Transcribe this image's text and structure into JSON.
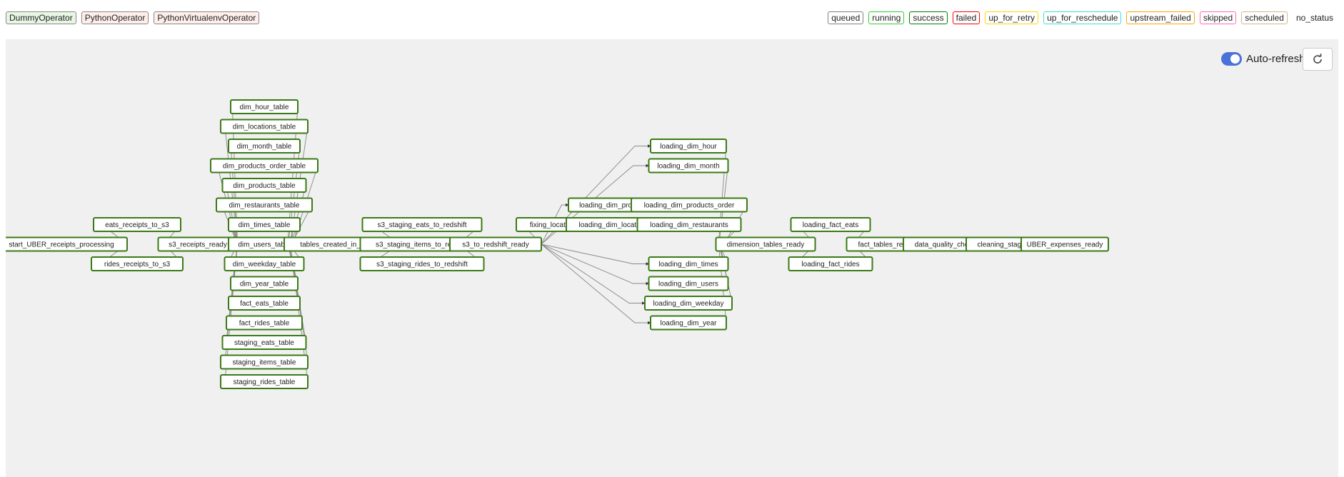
{
  "operators": [
    {
      "label": "DummyOperator",
      "color": "#e8f7e4",
      "border": "#888"
    },
    {
      "label": "PythonOperator",
      "color": "#ffefeb",
      "border": "#888"
    },
    {
      "label": "PythonVirtualenvOperator",
      "color": "#ffefeb",
      "border": "#888"
    }
  ],
  "statuses": [
    {
      "label": "queued",
      "color": "#808080"
    },
    {
      "label": "running",
      "color": "#32cd32"
    },
    {
      "label": "success",
      "color": "#008000"
    },
    {
      "label": "failed",
      "color": "#ff0000"
    },
    {
      "label": "up_for_retry",
      "color": "#ffd700"
    },
    {
      "label": "up_for_reschedule",
      "color": "#40e0d0"
    },
    {
      "label": "upstream_failed",
      "color": "#ffa500"
    },
    {
      "label": "skipped",
      "color": "#ff69b4"
    },
    {
      "label": "scheduled",
      "color": "#d2b48c"
    },
    {
      "label": "no_status",
      "color": ""
    }
  ],
  "controls": {
    "auto_refresh_label": "Auto-refresh",
    "auto_refresh_on": true,
    "refresh_icon": "refresh-icon"
  },
  "graph": {
    "node_stroke": "#3a7a15",
    "nodes": [
      {
        "id": "start_UBER_receipts_processing"
      },
      {
        "id": "eats_receipts_to_s3"
      },
      {
        "id": "rides_receipts_to_s3"
      },
      {
        "id": "s3_receipts_ready"
      },
      {
        "id": "dim_hour_table"
      },
      {
        "id": "dim_locations_table"
      },
      {
        "id": "dim_month_table"
      },
      {
        "id": "dim_products_order_table"
      },
      {
        "id": "dim_products_table"
      },
      {
        "id": "dim_restaurants_table"
      },
      {
        "id": "dim_times_table"
      },
      {
        "id": "dim_users_table"
      },
      {
        "id": "dim_weekday_table"
      },
      {
        "id": "dim_year_table"
      },
      {
        "id": "fact_eats_table"
      },
      {
        "id": "fact_rides_table"
      },
      {
        "id": "staging_eats_table"
      },
      {
        "id": "staging_items_table"
      },
      {
        "id": "staging_rides_table"
      },
      {
        "id": "tables_created_in_redshift"
      },
      {
        "id": "s3_staging_eats_to_redshift"
      },
      {
        "id": "s3_staging_items_to_redshift"
      },
      {
        "id": "s3_staging_rides_to_redshift"
      },
      {
        "id": "s3_to_redshift_ready"
      },
      {
        "id": "fixing_locations"
      },
      {
        "id": "loading_dim_products"
      },
      {
        "id": "loading_dim_locations"
      },
      {
        "id": "loading_dim_hour"
      },
      {
        "id": "loading_dim_month"
      },
      {
        "id": "loading_dim_products_order"
      },
      {
        "id": "loading_dim_restaurants"
      },
      {
        "id": "loading_dim_times"
      },
      {
        "id": "loading_dim_users"
      },
      {
        "id": "loading_dim_weekday"
      },
      {
        "id": "loading_dim_year"
      },
      {
        "id": "dimension_tables_ready"
      },
      {
        "id": "loading_fact_eats"
      },
      {
        "id": "loading_fact_rides"
      },
      {
        "id": "fact_tables_ready"
      },
      {
        "id": "data_quality_checks"
      },
      {
        "id": "cleaning_staging"
      },
      {
        "id": "UBER_expenses_ready"
      }
    ],
    "edges": [
      [
        "start_UBER_receipts_processing",
        "eats_receipts_to_s3"
      ],
      [
        "start_UBER_receipts_processing",
        "rides_receipts_to_s3"
      ],
      [
        "eats_receipts_to_s3",
        "s3_receipts_ready"
      ],
      [
        "rides_receipts_to_s3",
        "s3_receipts_ready"
      ],
      [
        "s3_receipts_ready",
        "dim_hour_table"
      ],
      [
        "s3_receipts_ready",
        "dim_locations_table"
      ],
      [
        "s3_receipts_ready",
        "dim_month_table"
      ],
      [
        "s3_receipts_ready",
        "dim_products_order_table"
      ],
      [
        "s3_receipts_ready",
        "dim_products_table"
      ],
      [
        "s3_receipts_ready",
        "dim_restaurants_table"
      ],
      [
        "s3_receipts_ready",
        "dim_times_table"
      ],
      [
        "s3_receipts_ready",
        "dim_users_table"
      ],
      [
        "s3_receipts_ready",
        "dim_weekday_table"
      ],
      [
        "s3_receipts_ready",
        "dim_year_table"
      ],
      [
        "s3_receipts_ready",
        "fact_eats_table"
      ],
      [
        "s3_receipts_ready",
        "fact_rides_table"
      ],
      [
        "s3_receipts_ready",
        "staging_eats_table"
      ],
      [
        "s3_receipts_ready",
        "staging_items_table"
      ],
      [
        "s3_receipts_ready",
        "staging_rides_table"
      ],
      [
        "dim_hour_table",
        "tables_created_in_redshift"
      ],
      [
        "dim_locations_table",
        "tables_created_in_redshift"
      ],
      [
        "dim_month_table",
        "tables_created_in_redshift"
      ],
      [
        "dim_products_order_table",
        "tables_created_in_redshift"
      ],
      [
        "dim_products_table",
        "tables_created_in_redshift"
      ],
      [
        "dim_restaurants_table",
        "tables_created_in_redshift"
      ],
      [
        "dim_times_table",
        "tables_created_in_redshift"
      ],
      [
        "dim_users_table",
        "tables_created_in_redshift"
      ],
      [
        "dim_weekday_table",
        "tables_created_in_redshift"
      ],
      [
        "dim_year_table",
        "tables_created_in_redshift"
      ],
      [
        "fact_eats_table",
        "tables_created_in_redshift"
      ],
      [
        "fact_rides_table",
        "tables_created_in_redshift"
      ],
      [
        "staging_eats_table",
        "tables_created_in_redshift"
      ],
      [
        "staging_items_table",
        "tables_created_in_redshift"
      ],
      [
        "staging_rides_table",
        "tables_created_in_redshift"
      ],
      [
        "tables_created_in_redshift",
        "s3_staging_eats_to_redshift"
      ],
      [
        "tables_created_in_redshift",
        "s3_staging_items_to_redshift"
      ],
      [
        "tables_created_in_redshift",
        "s3_staging_rides_to_redshift"
      ],
      [
        "s3_staging_eats_to_redshift",
        "s3_to_redshift_ready"
      ],
      [
        "s3_staging_items_to_redshift",
        "s3_to_redshift_ready"
      ],
      [
        "s3_staging_rides_to_redshift",
        "s3_to_redshift_ready"
      ],
      [
        "s3_to_redshift_ready",
        "loading_dim_hour"
      ],
      [
        "s3_to_redshift_ready",
        "loading_dim_month"
      ],
      [
        "s3_to_redshift_ready",
        "loading_dim_products"
      ],
      [
        "s3_to_redshift_ready",
        "fixing_locations"
      ],
      [
        "s3_to_redshift_ready",
        "loading_dim_times"
      ],
      [
        "s3_to_redshift_ready",
        "loading_dim_users"
      ],
      [
        "s3_to_redshift_ready",
        "loading_dim_weekday"
      ],
      [
        "s3_to_redshift_ready",
        "loading_dim_year"
      ],
      [
        "loading_dim_products",
        "loading_dim_products_order"
      ],
      [
        "fixing_locations",
        "loading_dim_locations"
      ],
      [
        "loading_dim_locations",
        "loading_dim_restaurants"
      ],
      [
        "loading_dim_hour",
        "dimension_tables_ready"
      ],
      [
        "loading_dim_month",
        "dimension_tables_ready"
      ],
      [
        "loading_dim_products_order",
        "dimension_tables_ready"
      ],
      [
        "loading_dim_restaurants",
        "dimension_tables_ready"
      ],
      [
        "loading_dim_times",
        "dimension_tables_ready"
      ],
      [
        "loading_dim_users",
        "dimension_tables_ready"
      ],
      [
        "loading_dim_weekday",
        "dimension_tables_ready"
      ],
      [
        "loading_dim_year",
        "dimension_tables_ready"
      ],
      [
        "dimension_tables_ready",
        "loading_fact_eats"
      ],
      [
        "dimension_tables_ready",
        "loading_fact_rides"
      ],
      [
        "loading_fact_eats",
        "fact_tables_ready"
      ],
      [
        "loading_fact_rides",
        "fact_tables_ready"
      ],
      [
        "fact_tables_ready",
        "data_quality_checks"
      ],
      [
        "data_quality_checks",
        "cleaning_staging"
      ],
      [
        "cleaning_staging",
        "UBER_expenses_ready"
      ]
    ]
  }
}
